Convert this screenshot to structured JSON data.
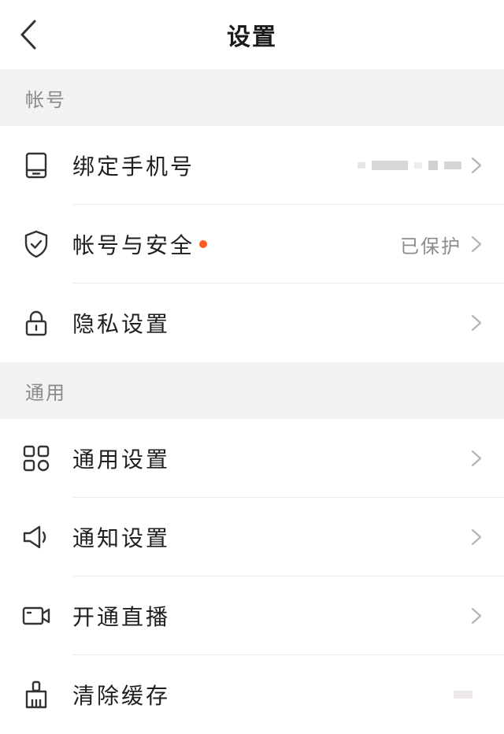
{
  "header": {
    "title": "设置"
  },
  "sections": [
    {
      "title": "帐号",
      "items": [
        {
          "label": "绑定手机号",
          "icon": "phone-icon",
          "value": "",
          "masked": true
        },
        {
          "label": "帐号与安全",
          "icon": "shield-icon",
          "value": "已保护",
          "dot": true
        },
        {
          "label": "隐私设置",
          "icon": "lock-icon",
          "value": ""
        }
      ]
    },
    {
      "title": "通用",
      "items": [
        {
          "label": "通用设置",
          "icon": "grid-icon",
          "value": ""
        },
        {
          "label": "通知设置",
          "icon": "speaker-icon",
          "value": ""
        },
        {
          "label": "开通直播",
          "icon": "video-camera-icon",
          "value": ""
        },
        {
          "label": "清除缓存",
          "icon": "brush-icon",
          "value": "",
          "masked_small": true
        }
      ]
    }
  ],
  "colors": {
    "accent_dot": "#ff5a1f",
    "section_bg": "#f2f2f2",
    "chevron": "#b5b5b5"
  }
}
